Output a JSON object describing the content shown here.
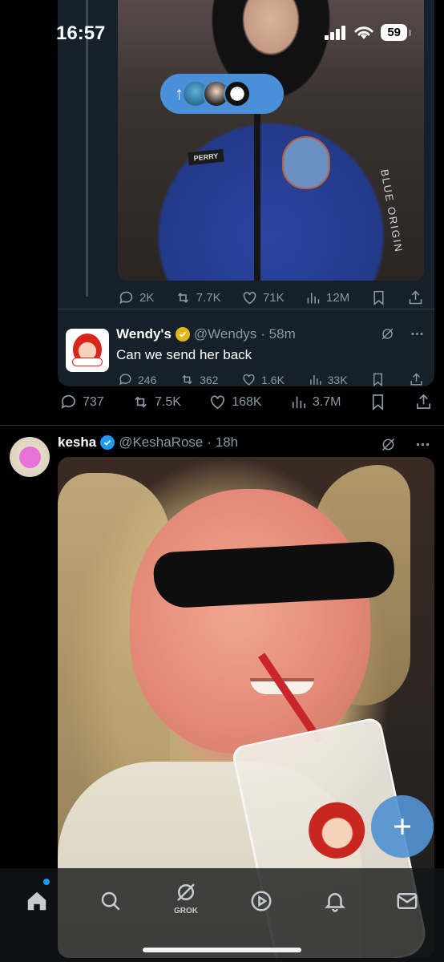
{
  "status_bar": {
    "time": "16:57",
    "battery": "59"
  },
  "new_posts_pill": {
    "arrow": "↑"
  },
  "quoted_post": {
    "name_tag": "PERRY",
    "suit_text": "BLUE ORIGIN",
    "actions": {
      "replies": "2K",
      "reposts": "7.7K",
      "likes": "71K",
      "views": "12M"
    }
  },
  "reply": {
    "name": "Wendy's",
    "handle": "@Wendys",
    "time": "· 58m",
    "text": "Can we send her back",
    "actions": {
      "replies": "246",
      "reposts": "362",
      "likes": "1.6K",
      "views": "33K"
    }
  },
  "main_post": {
    "actions": {
      "replies": "737",
      "reposts": "7.5K",
      "likes": "168K",
      "views": "3.7M"
    }
  },
  "kesha_post": {
    "name": "kesha",
    "handle": "@KeshaRose",
    "time": "· 18h"
  },
  "tab_bar": {
    "items": [
      "home",
      "search",
      "grok",
      "video",
      "notifications",
      "messages"
    ],
    "grok_label": "GROK"
  },
  "colors": {
    "accent": "#1d9bf0",
    "gold_badge": "#e2b719",
    "card_bg": "#15202b",
    "fab": "#5292d2"
  }
}
